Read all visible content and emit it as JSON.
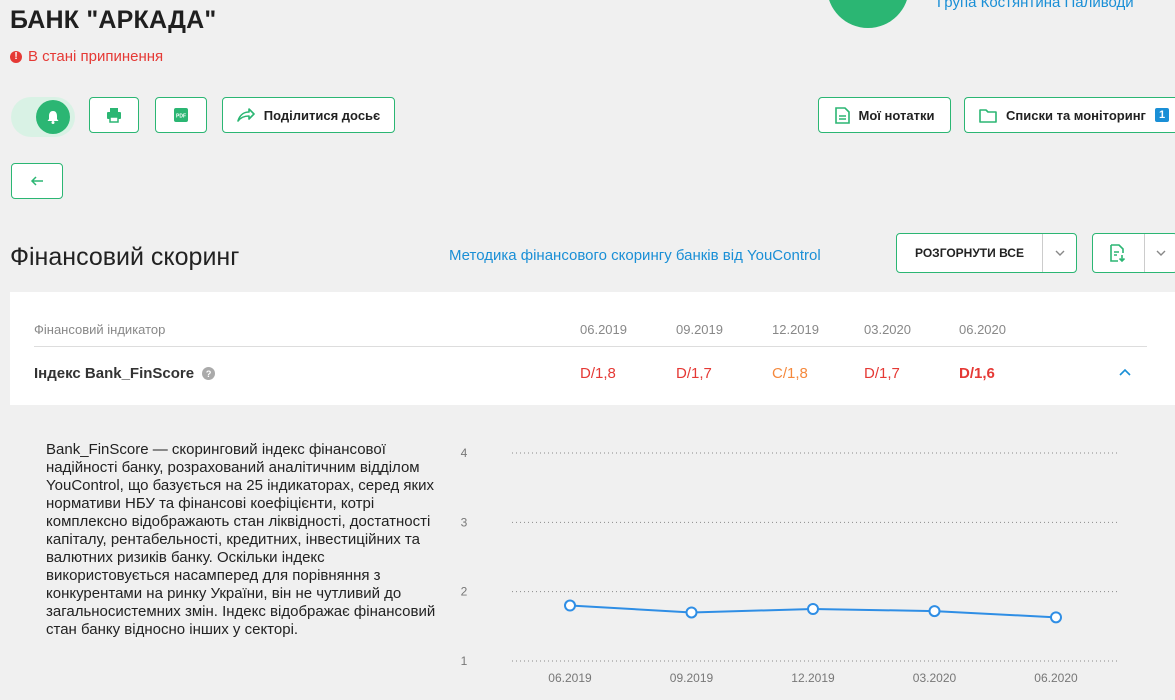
{
  "header": {
    "bank_name": "БАНК \"АРКАДА\"",
    "status": "В стані припинення",
    "group_link": "Група Костянтина Паливоди"
  },
  "toolbar": {
    "share_label": "Поділитися досьє",
    "pdf_badge": "PDF",
    "notes_label": "Мої нотатки",
    "lists_label": "Списки та моніторинг",
    "lists_count": "1"
  },
  "section": {
    "title": "Фінансовий скоринг",
    "method_link": "Методика фінансового скорингу банків від YouControl",
    "expand_all": "РОЗГОРНУТИ ВСЕ"
  },
  "table": {
    "indicator_header": "Фінансовий індикатор",
    "periods": [
      "06.2019",
      "09.2019",
      "12.2019",
      "03.2020",
      "06.2020"
    ],
    "row_label": "Індекс Bank_FinScore",
    "values": [
      "D/1,8",
      "D/1,7",
      "C/1,8",
      "D/1,7",
      "D/1,6"
    ]
  },
  "description": "Bank_FinScore — скоринговий індекс фінансової надійності банку, розрахований аналітичним відділом YouControl, що базується на 25 індикаторах, серед яких нормативи НБУ та фінансові коефіцієнти, котрі комплексно відображають стан ліквідності, достатності капіталу, рентабельності, кредитних, інвестиційних та валютних ризиків банку. Оскільки індекс використовується насамперед для порівняння з конкурентами на ринку України, він не чутливий до загальносистемних змін. Індекс відображає фінансовий стан банку відносно інших у секторі.",
  "colors": {
    "accent": "#2bb673",
    "link": "#1a8fd6",
    "grade_d": "#e53935",
    "grade_c": "#f5893d",
    "line": "#2f8ee5"
  },
  "chart_data": {
    "type": "line",
    "categories": [
      "06.2019",
      "09.2019",
      "12.2019",
      "03.2020",
      "06.2020"
    ],
    "yticks": [
      "1",
      "2",
      "3",
      "4"
    ],
    "series": [
      {
        "values": [
          1.8,
          1.7,
          1.75,
          1.72,
          1.63
        ]
      }
    ],
    "ylim": [
      1,
      4
    ],
    "grid": true
  }
}
